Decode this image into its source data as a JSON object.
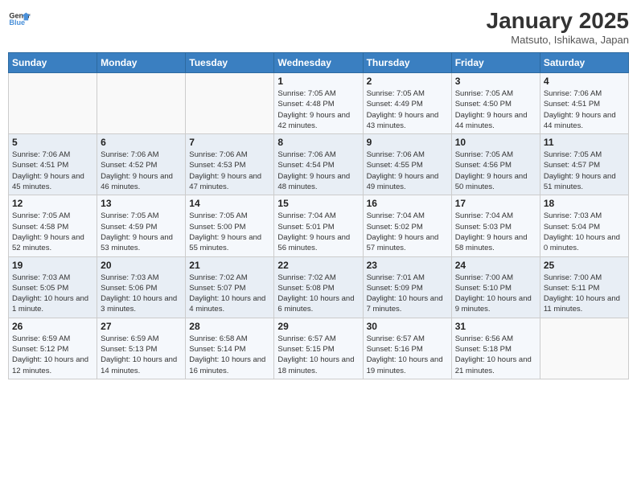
{
  "logo": {
    "line1": "General",
    "line2": "Blue"
  },
  "title": "January 2025",
  "subtitle": "Matsuto, Ishikawa, Japan",
  "days_of_week": [
    "Sunday",
    "Monday",
    "Tuesday",
    "Wednesday",
    "Thursday",
    "Friday",
    "Saturday"
  ],
  "weeks": [
    [
      {
        "day": "",
        "info": ""
      },
      {
        "day": "",
        "info": ""
      },
      {
        "day": "",
        "info": ""
      },
      {
        "day": "1",
        "info": "Sunrise: 7:05 AM\nSunset: 4:48 PM\nDaylight: 9 hours and 42 minutes."
      },
      {
        "day": "2",
        "info": "Sunrise: 7:05 AM\nSunset: 4:49 PM\nDaylight: 9 hours and 43 minutes."
      },
      {
        "day": "3",
        "info": "Sunrise: 7:05 AM\nSunset: 4:50 PM\nDaylight: 9 hours and 44 minutes."
      },
      {
        "day": "4",
        "info": "Sunrise: 7:06 AM\nSunset: 4:51 PM\nDaylight: 9 hours and 44 minutes."
      }
    ],
    [
      {
        "day": "5",
        "info": "Sunrise: 7:06 AM\nSunset: 4:51 PM\nDaylight: 9 hours and 45 minutes."
      },
      {
        "day": "6",
        "info": "Sunrise: 7:06 AM\nSunset: 4:52 PM\nDaylight: 9 hours and 46 minutes."
      },
      {
        "day": "7",
        "info": "Sunrise: 7:06 AM\nSunset: 4:53 PM\nDaylight: 9 hours and 47 minutes."
      },
      {
        "day": "8",
        "info": "Sunrise: 7:06 AM\nSunset: 4:54 PM\nDaylight: 9 hours and 48 minutes."
      },
      {
        "day": "9",
        "info": "Sunrise: 7:06 AM\nSunset: 4:55 PM\nDaylight: 9 hours and 49 minutes."
      },
      {
        "day": "10",
        "info": "Sunrise: 7:05 AM\nSunset: 4:56 PM\nDaylight: 9 hours and 50 minutes."
      },
      {
        "day": "11",
        "info": "Sunrise: 7:05 AM\nSunset: 4:57 PM\nDaylight: 9 hours and 51 minutes."
      }
    ],
    [
      {
        "day": "12",
        "info": "Sunrise: 7:05 AM\nSunset: 4:58 PM\nDaylight: 9 hours and 52 minutes."
      },
      {
        "day": "13",
        "info": "Sunrise: 7:05 AM\nSunset: 4:59 PM\nDaylight: 9 hours and 53 minutes."
      },
      {
        "day": "14",
        "info": "Sunrise: 7:05 AM\nSunset: 5:00 PM\nDaylight: 9 hours and 55 minutes."
      },
      {
        "day": "15",
        "info": "Sunrise: 7:04 AM\nSunset: 5:01 PM\nDaylight: 9 hours and 56 minutes."
      },
      {
        "day": "16",
        "info": "Sunrise: 7:04 AM\nSunset: 5:02 PM\nDaylight: 9 hours and 57 minutes."
      },
      {
        "day": "17",
        "info": "Sunrise: 7:04 AM\nSunset: 5:03 PM\nDaylight: 9 hours and 58 minutes."
      },
      {
        "day": "18",
        "info": "Sunrise: 7:03 AM\nSunset: 5:04 PM\nDaylight: 10 hours and 0 minutes."
      }
    ],
    [
      {
        "day": "19",
        "info": "Sunrise: 7:03 AM\nSunset: 5:05 PM\nDaylight: 10 hours and 1 minute."
      },
      {
        "day": "20",
        "info": "Sunrise: 7:03 AM\nSunset: 5:06 PM\nDaylight: 10 hours and 3 minutes."
      },
      {
        "day": "21",
        "info": "Sunrise: 7:02 AM\nSunset: 5:07 PM\nDaylight: 10 hours and 4 minutes."
      },
      {
        "day": "22",
        "info": "Sunrise: 7:02 AM\nSunset: 5:08 PM\nDaylight: 10 hours and 6 minutes."
      },
      {
        "day": "23",
        "info": "Sunrise: 7:01 AM\nSunset: 5:09 PM\nDaylight: 10 hours and 7 minutes."
      },
      {
        "day": "24",
        "info": "Sunrise: 7:00 AM\nSunset: 5:10 PM\nDaylight: 10 hours and 9 minutes."
      },
      {
        "day": "25",
        "info": "Sunrise: 7:00 AM\nSunset: 5:11 PM\nDaylight: 10 hours and 11 minutes."
      }
    ],
    [
      {
        "day": "26",
        "info": "Sunrise: 6:59 AM\nSunset: 5:12 PM\nDaylight: 10 hours and 12 minutes."
      },
      {
        "day": "27",
        "info": "Sunrise: 6:59 AM\nSunset: 5:13 PM\nDaylight: 10 hours and 14 minutes."
      },
      {
        "day": "28",
        "info": "Sunrise: 6:58 AM\nSunset: 5:14 PM\nDaylight: 10 hours and 16 minutes."
      },
      {
        "day": "29",
        "info": "Sunrise: 6:57 AM\nSunset: 5:15 PM\nDaylight: 10 hours and 18 minutes."
      },
      {
        "day": "30",
        "info": "Sunrise: 6:57 AM\nSunset: 5:16 PM\nDaylight: 10 hours and 19 minutes."
      },
      {
        "day": "31",
        "info": "Sunrise: 6:56 AM\nSunset: 5:18 PM\nDaylight: 10 hours and 21 minutes."
      },
      {
        "day": "",
        "info": ""
      }
    ]
  ]
}
